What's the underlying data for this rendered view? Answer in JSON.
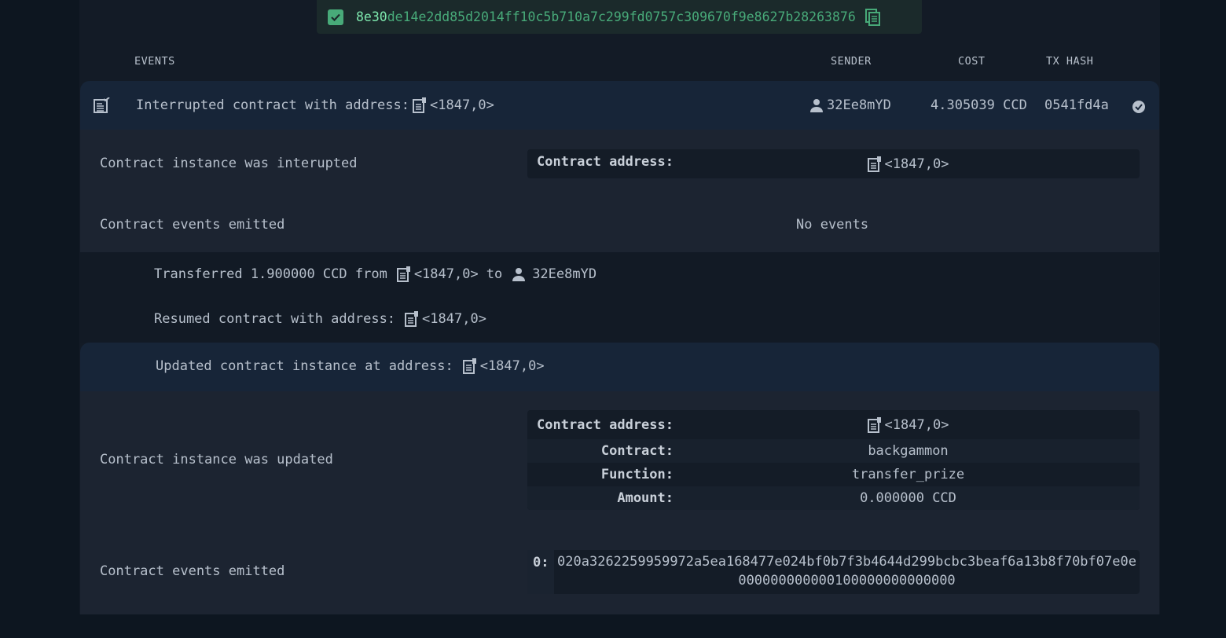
{
  "tx_hash": {
    "highlight": "8e30",
    "rest": "de14e2dd85d2014ff10c5b710a7c299fd0757c309670f9e8627b28263876"
  },
  "columns": {
    "events": "EVENTS",
    "sender": "SENDER",
    "cost": "COST",
    "tx_hash": "TX HASH"
  },
  "row": {
    "event_text": "Interrupted contract with address:",
    "address": "<1847,0>",
    "sender": "32Ee8mYD",
    "cost": "4.305039 CCD",
    "hash": "0541fd4a"
  },
  "interrupt": {
    "label": "Contract instance was interupted",
    "addr_key": "Contract address:",
    "addr_val": "<1847,0>",
    "events_label": "Contract events emitted",
    "no_events": "No events"
  },
  "transfer": {
    "prefix": "Transferred 1.900000 CCD from",
    "from": "<1847,0>",
    "to_word": "to",
    "to": "32Ee8mYD"
  },
  "resume": {
    "text": "Resumed contract with address:",
    "address": "<1847,0>"
  },
  "update": {
    "head_text": "Updated contract instance at address:",
    "head_address": "<1847,0>",
    "label": "Contract instance was updated",
    "fields": [
      {
        "key": "Contract address:",
        "value": "<1847,0>"
      },
      {
        "key": "Contract:",
        "value": "backgammon"
      },
      {
        "key": "Function:",
        "value": "transfer_prize"
      },
      {
        "key": "Amount:",
        "value": "0.000000 CCD"
      }
    ],
    "events_label": "Contract events emitted",
    "event_index": "0:",
    "event_hex": "020a3262259959972a5ea168477e024bf0b7f3b4644d299bcbc3beaf6a13b8f70bf07e0e000000000000100000000000000"
  },
  "colors": {
    "accent": "#48aa79",
    "panel": "#131b26",
    "header_row": "#172538"
  },
  "icons": [
    "check-icon",
    "copy-icon",
    "events-list-icon",
    "contract-icon",
    "user-icon",
    "success-check-icon"
  ]
}
